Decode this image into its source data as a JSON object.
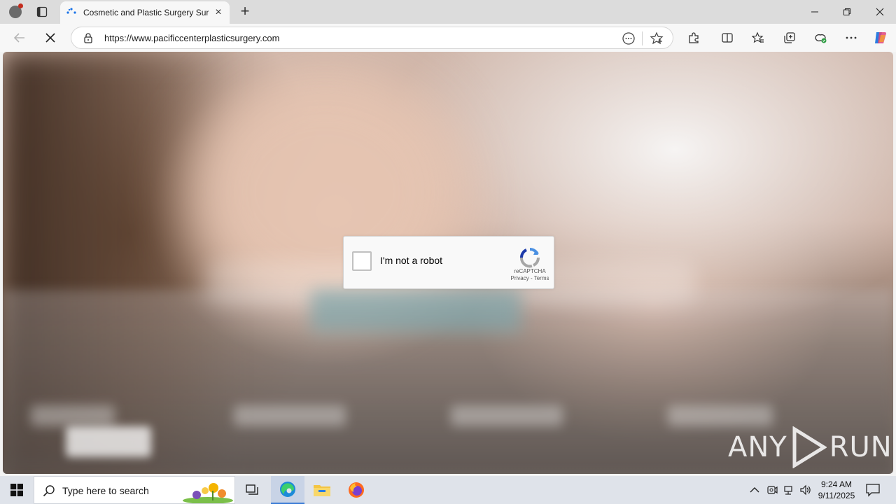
{
  "browser": {
    "tab_title": "Cosmetic and Plastic Surgery Surg",
    "url": "https://www.pacificcenterplasticsurgery.com",
    "new_tab_symbol": "+",
    "tab_close_symbol": "×"
  },
  "recaptcha": {
    "label": "I'm not a robot",
    "brand": "reCAPTCHA",
    "links": "Privacy - Terms",
    "checked": false
  },
  "watermark": {
    "left": "ANY",
    "right": "RUN"
  },
  "taskbar": {
    "search_placeholder": "Type here to search",
    "time": "9:24 AM",
    "date": "9/11/2025"
  },
  "colors": {
    "accent_blue": "#3a7bd5",
    "recaptcha_blue": "#4a90e2",
    "recaptcha_gray": "#a6a6a6"
  },
  "icons": [
    "profile-icon",
    "tab-actions-icon",
    "loading-spinner-icon",
    "close-icon",
    "new-tab-icon",
    "minimize-icon",
    "restore-icon",
    "window-close-icon",
    "back-icon",
    "stop-icon",
    "lock-icon",
    "read-aloud-icon",
    "favorite-star-icon",
    "extensions-icon",
    "split-screen-icon",
    "favorites-icon",
    "collections-icon",
    "browser-essentials-icon",
    "more-icon",
    "copilot-icon",
    "windows-start-icon",
    "search-icon",
    "task-view-icon",
    "edge-icon",
    "file-explorer-icon",
    "firefox-icon",
    "chevron-up-icon",
    "meet-now-icon",
    "network-icon",
    "volume-icon",
    "notification-icon"
  ]
}
